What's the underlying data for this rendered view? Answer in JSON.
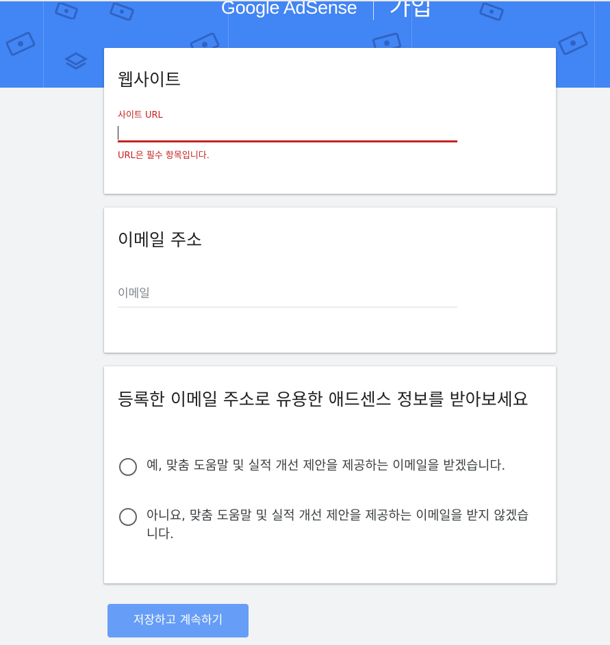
{
  "header": {
    "logo": "Google AdSense",
    "title": "가입",
    "bg_color": "#4285f4"
  },
  "website_card": {
    "title": "웹사이트",
    "url_label": "사이트 URL",
    "url_value": "",
    "error": "URL은 필수 항목입니다.",
    "error_color": "#c5221f"
  },
  "email_card": {
    "title": "이메일 주소",
    "email_placeholder": "이메일",
    "email_value": ""
  },
  "newsletter_card": {
    "title": "등록한 이메일 주소로 유용한 애드센스 정보를 받아보세요",
    "options": [
      {
        "label": "예, 맞춤 도움말 및 실적 개선 제안을 제공하는 이메일을 받겠습니다.",
        "selected": false
      },
      {
        "label": "아니요, 맞춤 도움말 및 실적 개선 제안을 제공하는 이메일을 받지 않겠습니다.",
        "selected": false
      }
    ]
  },
  "actions": {
    "submit_label": "저장하고 계속하기",
    "button_color": "#669df6"
  }
}
